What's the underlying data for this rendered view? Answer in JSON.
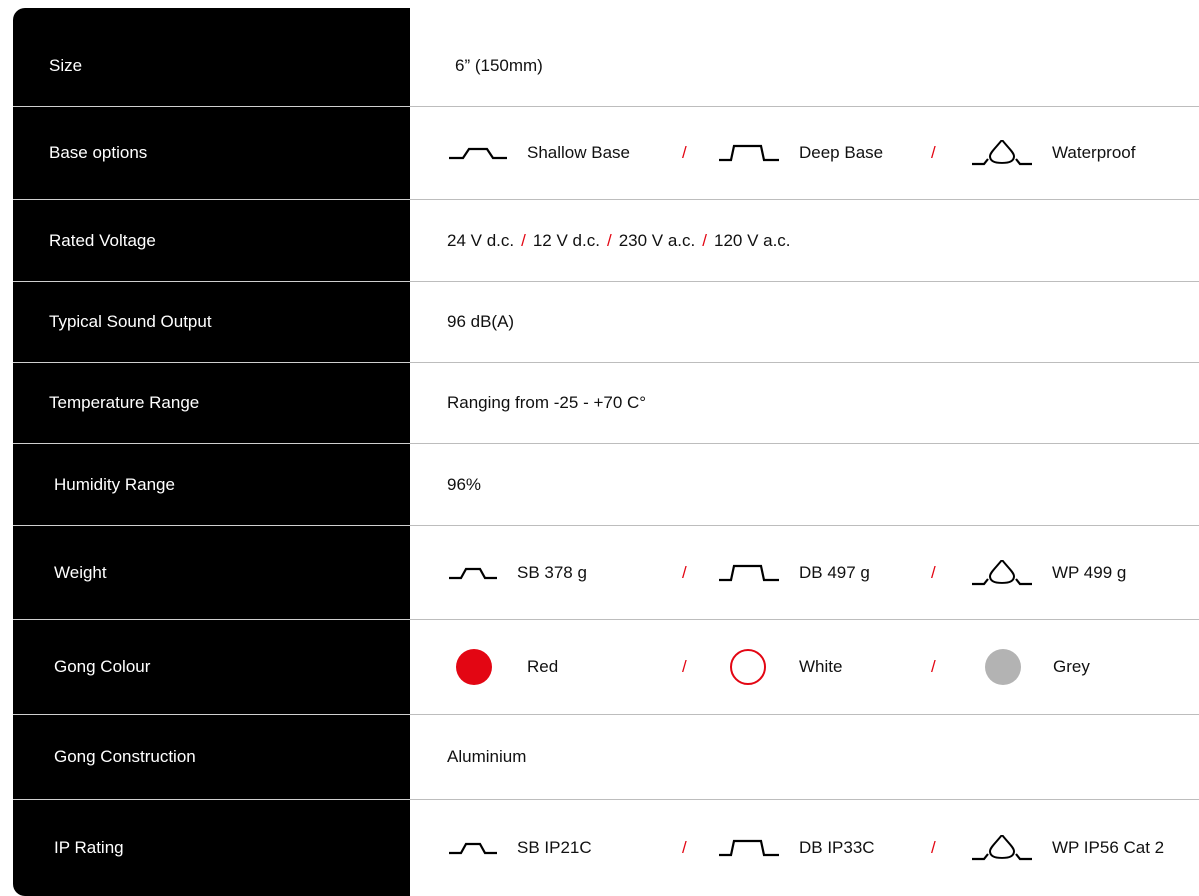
{
  "rows": {
    "size": {
      "label": "Size",
      "value": "6” (150mm)"
    },
    "base_options": {
      "label": "Base options",
      "items": [
        "Shallow Base",
        "Deep Base",
        "Waterproof"
      ],
      "separator": "/"
    },
    "rated_voltage": {
      "label": "Rated Voltage",
      "items": [
        "24 V d.c.",
        "12 V d.c.",
        "230 V a.c.",
        "120 V a.c."
      ],
      "separator": "/"
    },
    "sound_output": {
      "label": "Typical Sound Output",
      "value": "96 dB(A)"
    },
    "temperature": {
      "label": "Temperature Range",
      "value": "Ranging from -25 - +70 C°"
    },
    "humidity": {
      "label": "Humidity Range",
      "value": "96%"
    },
    "weight": {
      "label": "Weight",
      "items": [
        "SB 378 g",
        "DB 497 g",
        "WP 499 g"
      ],
      "separator": "/"
    },
    "gong_colour": {
      "label": "Gong Colour",
      "items": [
        "Red",
        "White",
        "Grey"
      ],
      "separator": "/"
    },
    "gong_construction": {
      "label": "Gong Construction",
      "value": "Aluminium"
    },
    "ip_rating": {
      "label": "IP Rating",
      "items": [
        "SB IP21C",
        "DB IP33C",
        "WP IP56 Cat 2"
      ],
      "separator": "/"
    }
  },
  "colors": {
    "accent": "#e30613",
    "grey_swatch": "#b3b3b3",
    "label_bg": "#000000"
  },
  "icons": [
    "shallow-base-icon",
    "deep-base-icon",
    "waterproof-icon"
  ]
}
